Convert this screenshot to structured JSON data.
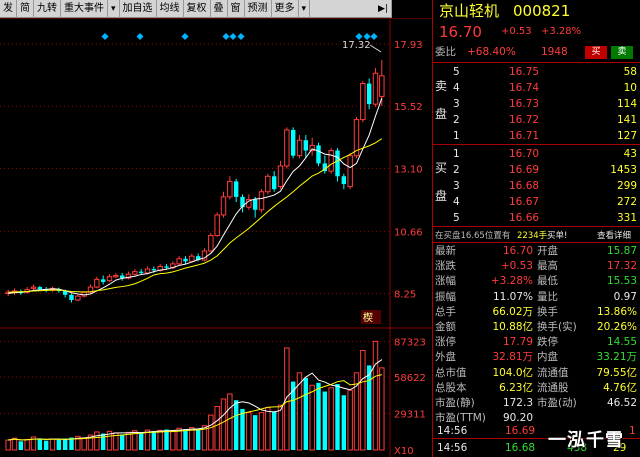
{
  "toolbar": {
    "items": [
      "发",
      "简",
      "九转",
      "重大事件",
      "▾",
      "加自选",
      "均线",
      "复权",
      "叠",
      "窗",
      "预测",
      "更多",
      "▾"
    ],
    "end_icon": "arrow-right-icon"
  },
  "price_axis": {
    "ticks": [
      "17.93",
      "15.52",
      "13.10",
      "10.66",
      "8.25"
    ],
    "max_label": "17.32"
  },
  "volume_axis": {
    "ticks": [
      "87323",
      "58622",
      "29311"
    ],
    "unit": "X10"
  },
  "tag": "楔",
  "quote": {
    "name": "京山轻机",
    "code": "000821",
    "price": "16.70",
    "change": "+0.53",
    "pct": "+3.28%"
  },
  "weibi": {
    "label": "委比",
    "pct": "+68.40%",
    "diff": "1948",
    "buy": "买",
    "sell": "卖"
  },
  "asks": {
    "side": [
      "卖",
      "盘"
    ],
    "rows": [
      {
        "lvl": "5",
        "price": "16.75",
        "vol": "58"
      },
      {
        "lvl": "4",
        "price": "16.74",
        "vol": "10"
      },
      {
        "lvl": "3",
        "price": "16.73",
        "vol": "114"
      },
      {
        "lvl": "2",
        "price": "16.72",
        "vol": "141"
      },
      {
        "lvl": "1",
        "price": "16.71",
        "vol": "127"
      }
    ]
  },
  "bids": {
    "side": [
      "买",
      "盘"
    ],
    "rows": [
      {
        "lvl": "1",
        "price": "16.70",
        "vol": "43"
      },
      {
        "lvl": "2",
        "price": "16.69",
        "vol": "1453"
      },
      {
        "lvl": "3",
        "price": "16.68",
        "vol": "299"
      },
      {
        "lvl": "4",
        "price": "16.67",
        "vol": "272"
      },
      {
        "lvl": "5",
        "price": "16.66",
        "vol": "331"
      }
    ]
  },
  "info_bar": {
    "text": "在买盘16.65位置有",
    "qty": "2234手",
    "action": "买单!",
    "detail": "查看详细"
  },
  "stats": [
    {
      "l1": "最新",
      "v1": "16.70",
      "c1": "red",
      "l2": "开盘",
      "v2": "15.87",
      "c2": "grn"
    },
    {
      "l1": "涨跌",
      "v1": "+0.53",
      "c1": "red",
      "l2": "最高",
      "v2": "17.32",
      "c2": "red"
    },
    {
      "l1": "涨幅",
      "v1": "+3.28%",
      "c1": "red",
      "l2": "最低",
      "v2": "15.53",
      "c2": "grn"
    },
    {
      "l1": "振幅",
      "v1": "11.07%",
      "c1": "wht",
      "l2": "量比",
      "v2": "0.97",
      "c2": "wht"
    },
    {
      "l1": "总手",
      "v1": "66.02万",
      "c1": "yel",
      "l2": "换手",
      "v2": "13.86%",
      "c2": "yel"
    },
    {
      "l1": "金额",
      "v1": "10.88亿",
      "c1": "yel",
      "l2": "换手(实)",
      "v2": "20.26%",
      "c2": "yel"
    },
    {
      "l1": "涨停",
      "v1": "17.79",
      "c1": "red",
      "l2": "跌停",
      "v2": "14.55",
      "c2": "grn"
    },
    {
      "l1": "外盘",
      "v1": "32.81万",
      "c1": "red",
      "l2": "内盘",
      "v2": "33.21万",
      "c2": "grn"
    },
    {
      "l1": "总市值",
      "v1": "104.0亿",
      "c1": "yel",
      "l2": "流通值",
      "v2": "79.55亿",
      "c2": "yel"
    },
    {
      "l1": "总股本",
      "v1": "6.23亿",
      "c1": "yel",
      "l2": "流通股",
      "v2": "4.76亿",
      "c2": "yel"
    },
    {
      "l1": "市盈(静)",
      "v1": "172.3",
      "c1": "wht",
      "l2": "市盈(动)",
      "v2": "46.52",
      "c2": "wht"
    },
    {
      "l1": "市盈(TTM)",
      "v1": "90.20",
      "c1": "wht",
      "l2": "",
      "v2": "",
      "c2": "wht"
    }
  ],
  "ticks": [
    {
      "time": "14:56",
      "price": "16.69",
      "vol": "1"
    },
    {
      "time": "14:56",
      "price": "16.68",
      "vol": "438",
      "vol2": "29"
    }
  ],
  "watermark": "一泓千雪",
  "colors": {
    "up": "#ff3c3c",
    "down": "#00ffff",
    "ma1": "#ffffff",
    "ma2": "#ffff00",
    "grid": "#8b0000"
  },
  "chart_data": {
    "type": "candlestick",
    "ylim": [
      7.3,
      18.4
    ],
    "candles": [
      {
        "o": 8.25,
        "c": 8.3,
        "h": 8.4,
        "l": 8.15
      },
      {
        "o": 8.3,
        "c": 8.35,
        "h": 8.45,
        "l": 8.2
      },
      {
        "o": 8.3,
        "c": 8.28,
        "h": 8.4,
        "l": 8.2
      },
      {
        "o": 8.3,
        "c": 8.4,
        "h": 8.5,
        "l": 8.25
      },
      {
        "o": 8.45,
        "c": 8.5,
        "h": 8.6,
        "l": 8.35
      },
      {
        "o": 8.5,
        "c": 8.42,
        "h": 8.55,
        "l": 8.35
      },
      {
        "o": 8.42,
        "c": 8.38,
        "h": 8.5,
        "l": 8.3
      },
      {
        "o": 8.38,
        "c": 8.45,
        "h": 8.52,
        "l": 8.32
      },
      {
        "o": 8.4,
        "c": 8.35,
        "h": 8.48,
        "l": 8.28
      },
      {
        "o": 8.35,
        "c": 8.2,
        "h": 8.4,
        "l": 8.1
      },
      {
        "o": 8.2,
        "c": 8.0,
        "h": 8.25,
        "l": 7.9
      },
      {
        "o": 8.0,
        "c": 8.15,
        "h": 8.2,
        "l": 7.95
      },
      {
        "o": 8.15,
        "c": 8.3,
        "h": 8.35,
        "l": 8.1
      },
      {
        "o": 8.3,
        "c": 8.5,
        "h": 8.6,
        "l": 8.25
      },
      {
        "o": 8.5,
        "c": 8.8,
        "h": 8.9,
        "l": 8.45
      },
      {
        "o": 8.8,
        "c": 8.7,
        "h": 8.95,
        "l": 8.6
      },
      {
        "o": 8.75,
        "c": 8.9,
        "h": 9.0,
        "l": 8.7
      },
      {
        "o": 8.9,
        "c": 8.95,
        "h": 9.05,
        "l": 8.85
      },
      {
        "o": 8.95,
        "c": 8.85,
        "h": 9.05,
        "l": 8.75
      },
      {
        "o": 8.85,
        "c": 9.0,
        "h": 9.1,
        "l": 8.8
      },
      {
        "o": 9.0,
        "c": 9.1,
        "h": 9.2,
        "l": 8.95
      },
      {
        "o": 9.1,
        "c": 9.05,
        "h": 9.2,
        "l": 9.0
      },
      {
        "o": 9.05,
        "c": 9.2,
        "h": 9.3,
        "l": 9.0
      },
      {
        "o": 9.2,
        "c": 9.15,
        "h": 9.3,
        "l": 9.05
      },
      {
        "o": 9.15,
        "c": 9.3,
        "h": 9.4,
        "l": 9.1
      },
      {
        "o": 9.3,
        "c": 9.25,
        "h": 9.4,
        "l": 9.2
      },
      {
        "o": 9.25,
        "c": 9.4,
        "h": 9.5,
        "l": 9.2
      },
      {
        "o": 9.4,
        "c": 9.6,
        "h": 9.7,
        "l": 9.35
      },
      {
        "o": 9.6,
        "c": 9.5,
        "h": 9.7,
        "l": 9.4
      },
      {
        "o": 9.5,
        "c": 9.7,
        "h": 9.8,
        "l": 9.45
      },
      {
        "o": 9.7,
        "c": 9.55,
        "h": 9.8,
        "l": 9.5
      },
      {
        "o": 9.55,
        "c": 9.9,
        "h": 10.0,
        "l": 9.5
      },
      {
        "o": 9.9,
        "c": 10.5,
        "h": 10.6,
        "l": 9.85
      },
      {
        "o": 10.5,
        "c": 11.3,
        "h": 11.4,
        "l": 10.45
      },
      {
        "o": 11.3,
        "c": 12.0,
        "h": 12.2,
        "l": 11.2
      },
      {
        "o": 12.0,
        "c": 12.6,
        "h": 12.8,
        "l": 11.9
      },
      {
        "o": 12.6,
        "c": 12.0,
        "h": 12.7,
        "l": 11.8
      },
      {
        "o": 12.0,
        "c": 11.6,
        "h": 12.1,
        "l": 11.4
      },
      {
        "o": 11.6,
        "c": 11.9,
        "h": 12.1,
        "l": 11.5
      },
      {
        "o": 11.9,
        "c": 11.5,
        "h": 12.0,
        "l": 11.2
      },
      {
        "o": 11.5,
        "c": 12.2,
        "h": 12.3,
        "l": 11.4
      },
      {
        "o": 12.2,
        "c": 12.8,
        "h": 12.9,
        "l": 12.1
      },
      {
        "o": 12.8,
        "c": 12.3,
        "h": 13.0,
        "l": 12.2
      },
      {
        "o": 12.4,
        "c": 13.2,
        "h": 13.4,
        "l": 12.3
      },
      {
        "o": 13.2,
        "c": 14.6,
        "h": 14.7,
        "l": 13.1
      },
      {
        "o": 14.6,
        "c": 13.6,
        "h": 14.7,
        "l": 13.5
      },
      {
        "o": 13.6,
        "c": 14.2,
        "h": 14.4,
        "l": 13.5
      },
      {
        "o": 14.2,
        "c": 13.8,
        "h": 14.4,
        "l": 13.5
      },
      {
        "o": 13.8,
        "c": 14.0,
        "h": 14.3,
        "l": 13.6
      },
      {
        "o": 14.0,
        "c": 13.3,
        "h": 14.1,
        "l": 13.2
      },
      {
        "o": 13.3,
        "c": 13.0,
        "h": 13.6,
        "l": 12.9
      },
      {
        "o": 13.0,
        "c": 13.8,
        "h": 13.9,
        "l": 12.9
      },
      {
        "o": 13.8,
        "c": 12.8,
        "h": 13.9,
        "l": 12.6
      },
      {
        "o": 12.8,
        "c": 12.5,
        "h": 12.9,
        "l": 12.3
      },
      {
        "o": 12.4,
        "c": 13.6,
        "h": 13.7,
        "l": 12.3
      },
      {
        "o": 13.6,
        "c": 15.0,
        "h": 15.1,
        "l": 13.5
      },
      {
        "o": 15.0,
        "c": 16.4,
        "h": 16.5,
        "l": 14.9
      },
      {
        "o": 16.4,
        "c": 15.6,
        "h": 16.6,
        "l": 15.4
      },
      {
        "o": 15.6,
        "c": 16.8,
        "h": 17.0,
        "l": 15.5
      },
      {
        "o": 15.9,
        "c": 16.7,
        "h": 17.32,
        "l": 15.53
      }
    ],
    "volumes": [
      8000,
      9500,
      7000,
      8500,
      10500,
      9000,
      7500,
      8800,
      8200,
      9200,
      10000,
      11000,
      9800,
      12000,
      14500,
      13200,
      15000,
      13800,
      12500,
      14200,
      15500,
      13600,
      16000,
      14800,
      15800,
      16500,
      15200,
      17500,
      16800,
      18000,
      17200,
      19500,
      28000,
      35000,
      41000,
      45000,
      40000,
      33000,
      30000,
      28000,
      30000,
      34000,
      31000,
      36000,
      82000,
      55000,
      62000,
      58000,
      52000,
      54000,
      47000,
      50000,
      53000,
      44000,
      48000,
      62000,
      80000,
      68000,
      87323,
      66000
    ],
    "ma5": [
      8.26,
      8.28,
      8.3,
      8.32,
      8.37,
      8.39,
      8.41,
      8.43,
      8.42,
      8.36,
      8.28,
      8.23,
      8.2,
      8.23,
      8.35,
      8.47,
      8.61,
      8.77,
      8.84,
      8.88,
      8.92,
      8.99,
      9.02,
      9.1,
      9.16,
      9.19,
      9.26,
      9.34,
      9.39,
      9.47,
      9.57,
      9.63,
      9.81,
      10.09,
      10.52,
      10.93,
      11.34,
      11.64,
      11.84,
      11.92,
      11.94,
      12.0,
      12.07,
      12.22,
      12.63,
      12.99,
      13.2,
      13.52,
      13.86,
      13.78,
      13.66,
      13.62,
      13.54,
      13.28,
      13.14,
      13.3,
      13.86,
      14.4,
      15.14,
      15.83
    ],
    "ma10": [
      8.3,
      8.31,
      8.32,
      8.33,
      8.35,
      8.36,
      8.37,
      8.38,
      8.38,
      8.36,
      8.33,
      8.32,
      8.31,
      8.32,
      8.36,
      8.39,
      8.44,
      8.49,
      8.52,
      8.56,
      8.63,
      8.73,
      8.84,
      8.97,
      9.02,
      9.04,
      9.09,
      9.16,
      9.24,
      9.3,
      9.36,
      9.43,
      9.55,
      9.71,
      9.96,
      10.21,
      10.41,
      10.59,
      10.78,
      10.99,
      11.21,
      11.43,
      11.63,
      11.82,
      12.0,
      12.2,
      12.42,
      12.61,
      12.81,
      12.92,
      13.08,
      13.27,
      13.4,
      13.53,
      13.65,
      13.8,
      13.89,
      13.98,
      14.1,
      14.26
    ]
  }
}
